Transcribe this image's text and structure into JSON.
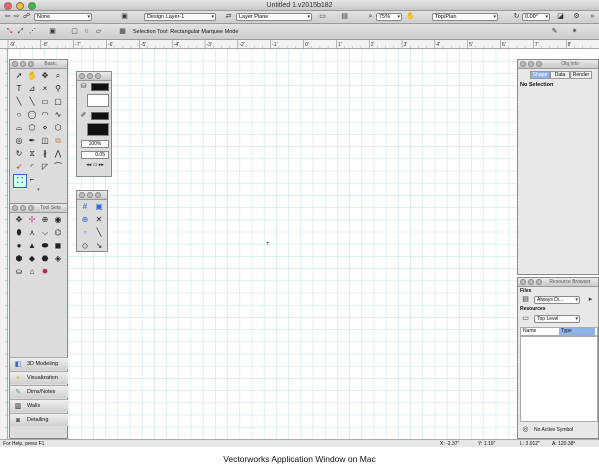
{
  "window": {
    "title": "Untitled 1.v2015b182"
  },
  "view_bar": {
    "view_value": "None",
    "design_layer": "Design Layer-1",
    "layer_plane": "Layer Plane",
    "zoom": "75%",
    "view": "Top/Plan",
    "rotation": "0.00°"
  },
  "mode_bar": {
    "hint": "Selection Tool: Rectangular Marquee Mode"
  },
  "rulers": {
    "top_labels": [
      "-9'",
      "-8'",
      "-7'",
      "-6'",
      "-5'",
      "-4'",
      "-3'",
      "-2'",
      "-1'",
      "0'",
      "1'",
      "2'",
      "3'",
      "4'",
      "5'",
      "6'",
      "7'",
      "8'"
    ]
  },
  "palettes": {
    "basic": {
      "title": "Basic"
    },
    "attributes": {
      "opacity": "100%",
      "line_weight": "0.05"
    },
    "tool_sets": {
      "title": "Tool Sets",
      "sets": [
        {
          "label": "3D Modeling",
          "icon": "cube-icon"
        },
        {
          "label": "Visualization",
          "icon": "lamp-icon"
        },
        {
          "label": "Dims/Notes",
          "icon": "dims-icon"
        },
        {
          "label": "Walls",
          "icon": "wall-icon"
        },
        {
          "label": "Detailing",
          "icon": "detail-icon"
        }
      ]
    }
  },
  "obj_info": {
    "title": "Obj Info",
    "tabs": [
      "Shape",
      "Data",
      "Render"
    ],
    "selection": "No Selection"
  },
  "resource_browser": {
    "title": "Resource Browser",
    "files_label": "Files",
    "files_value": "Always Di...",
    "resources_label": "Resources",
    "level_value": "Top Level",
    "col_name": "Name",
    "col_type": "Type",
    "footer": "No Active Symbol"
  },
  "status_bar": {
    "help": "For Help, press F1",
    "x": "X: -2.37\"",
    "y": "Y: 1.19\"",
    "l": "L: 3.912\"",
    "a": "A: 120.38°"
  },
  "caption": "Vectorworks Application Window on Mac",
  "colors": {
    "grid": "#c5e4ee",
    "selected_tab": "#8fb3e8"
  }
}
